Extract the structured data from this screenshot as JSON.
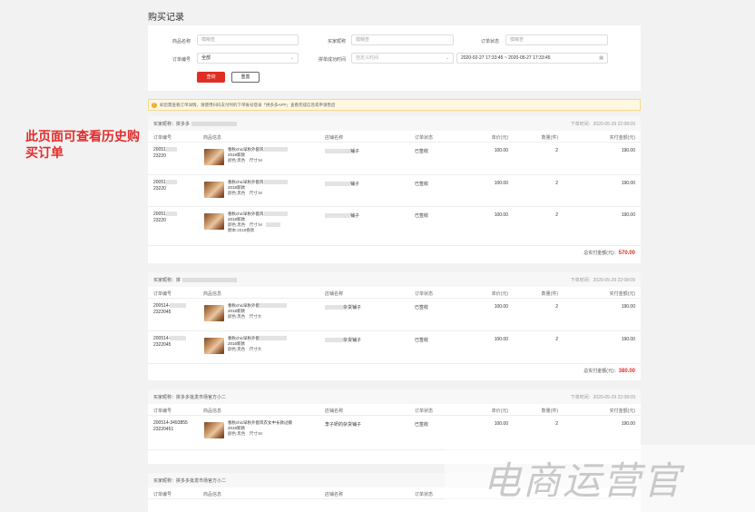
{
  "page": {
    "title": "购买记录"
  },
  "annotation": "此页面可查看历史购买订单",
  "filters": {
    "goods_label": "商品名称",
    "goods_ph": "模糊查",
    "buyer_label": "买家昵称",
    "buyer_ph": "模糊查",
    "status_label": "订单状态",
    "status_ph": "模糊查",
    "order_label": "订单编号",
    "order_value": "全部",
    "time_label": "拼单成功时间",
    "time_ph": "自定义时间",
    "range_value": "2020-02-27 17:33:45 ~ 2020-05-27 17:33:45",
    "query_btn": "查询",
    "reset_btn": "重置"
  },
  "notice": "如您需查看订单详情，请使用扫码支付时的下单账号登录「拼多多APP」查看完成信息或申请售后",
  "columns": {
    "no": "订单编号",
    "info": "商品信息",
    "shop": "店铺名称",
    "status": "订单状态",
    "price": "单价(元)",
    "qty": "数量(件)",
    "total": "实付金额(元)"
  },
  "orders": [
    {
      "buyer": "买家昵称：拼多多",
      "time": "下单时间：2020-05-29 22:08:09",
      "rows": [
        {
          "no1": "20051",
          "no2": "23220",
          "title": "春秋chic早秋外套风",
          "l2": "2018新款",
          "l3": "颜色:黑色　尺寸:M",
          "l4": "",
          "shop": "铺子",
          "status": "已签收",
          "price": "100.00",
          "qty": "2",
          "total": "190.00"
        },
        {
          "no1": "20051",
          "no2": "23220",
          "title": "春秋chic早秋外套风",
          "l2": "2018新款",
          "l3": "颜色:黑色　尺寸:M",
          "l4": "",
          "shop": "铺子",
          "status": "已签收",
          "price": "100.00",
          "qty": "2",
          "total": "190.00"
        },
        {
          "no1": "20051",
          "no2": "23220",
          "title": "春秋chic早秋外套风",
          "l2": "2018新款",
          "l3": "颜色:黑色　尺寸:M",
          "l4": "顏本:2018春款",
          "shop": "铺子",
          "status": "已签收",
          "price": "100.00",
          "qty": "2",
          "total": "190.00"
        }
      ],
      "sum_label": "总实付金额(元)：",
      "sum": "570.00"
    },
    {
      "buyer": "买家昵称：拼",
      "time": "下单时间：2020-05-29 22:08:09",
      "rows": [
        {
          "no1": "200514-",
          "no2": "2322045",
          "title": "春秋chic早秋外套",
          "l2": "2018新款",
          "l3": "颜色:黑色　尺寸大",
          "l4": "",
          "shop": "杂货铺子",
          "status": "已签收",
          "price": "100.00",
          "qty": "2",
          "total": "190.00"
        },
        {
          "no1": "200514-",
          "no2": "2322045",
          "title": "春秋chic早秋外套",
          "l2": "2018新款",
          "l3": "颜色:黑色　尺寸大",
          "l4": "",
          "shop": "杂货铺子",
          "status": "已签收",
          "price": "100.00",
          "qty": "2",
          "total": "190.00"
        }
      ],
      "sum_label": "总实付金额(元)：",
      "sum": "380.00"
    },
    {
      "buyer": "买家昵称：拼多多批发市场官方小二",
      "time": "下单时间：2020-05-29 22:08:09",
      "rows": [
        {
          "no1": "200514-3493855",
          "no2": "23220451",
          "title": "春秋chic早秋外套风衣女中长款过膝",
          "l2": "2018新款",
          "l3": "颜色:黑色　尺寸:M",
          "l4": "",
          "shop": "李子妍的杂货铺子",
          "status": "已签收",
          "price": "100.00",
          "qty": "2",
          "total": "190.00"
        }
      ]
    },
    {
      "buyer": "买家昵称：拼多多批发市场官方小二",
      "time": "",
      "rows": []
    }
  ],
  "watermark": "电商运营官"
}
